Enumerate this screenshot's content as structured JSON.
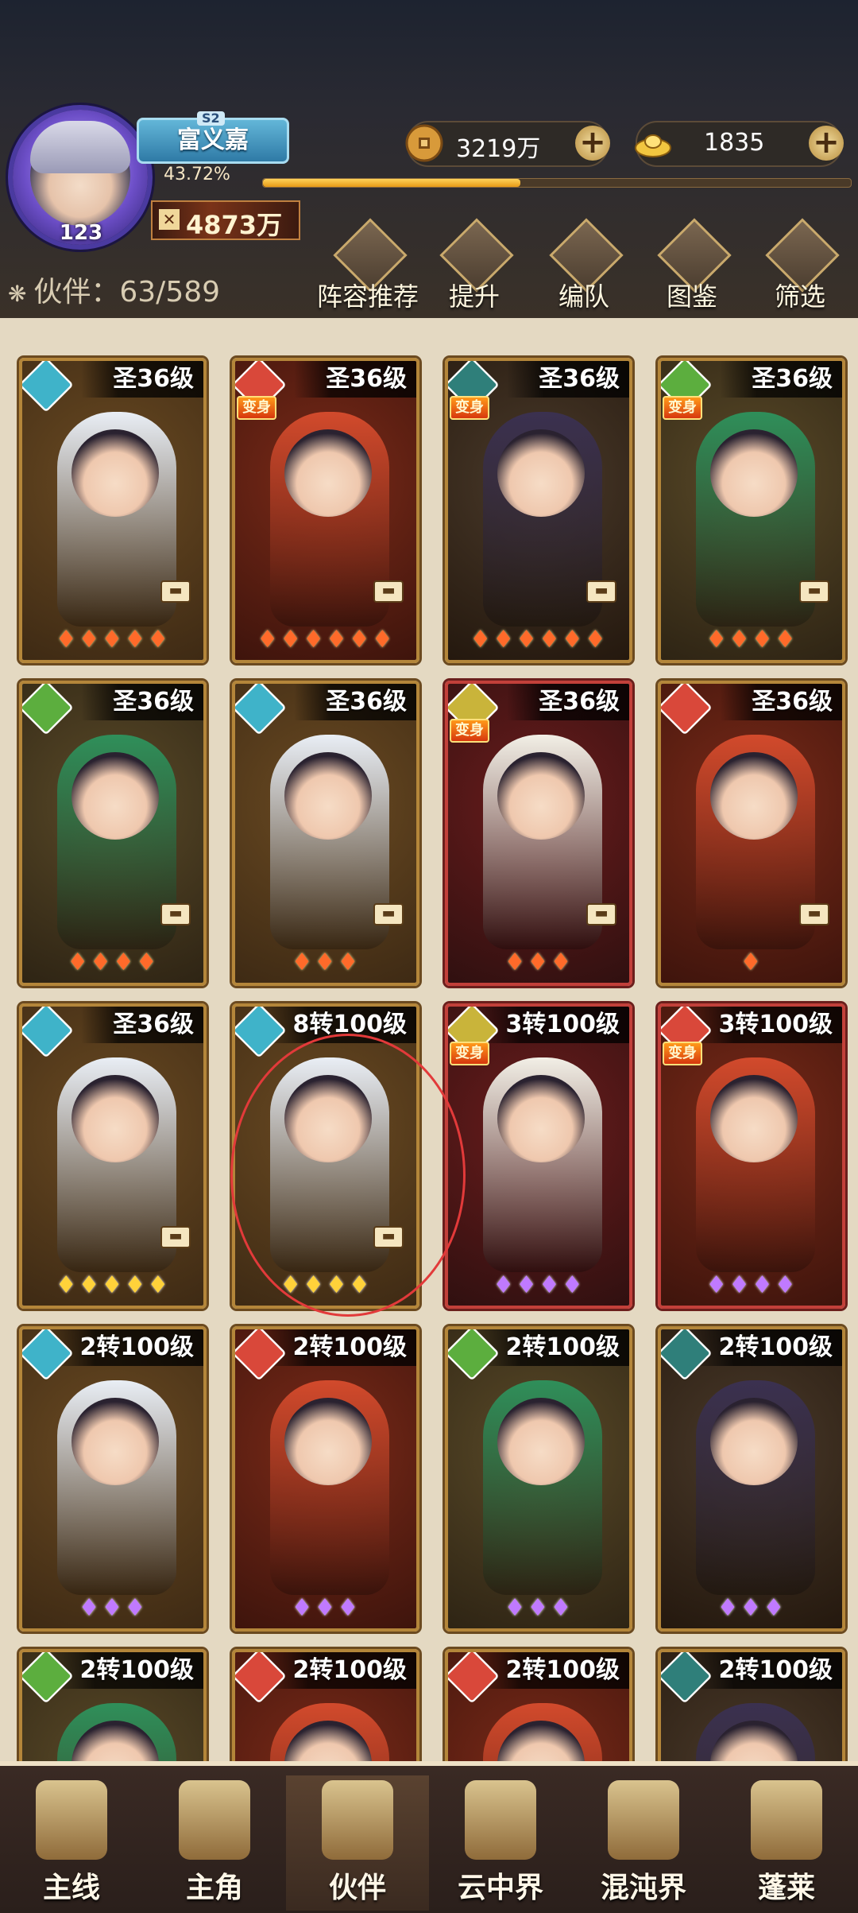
{
  "player": {
    "name": "富义嘉",
    "season": "S2",
    "level": "123",
    "exp_percent": "43.72%",
    "exp_fraction": 0.4372,
    "power": "4873万"
  },
  "resources": {
    "coins": "3219万",
    "ingots": "1835"
  },
  "partner_count": "伙伴：63/589",
  "features": [
    {
      "label": "阵容推荐",
      "icon": "lineup-recommend-icon"
    },
    {
      "label": "提升",
      "icon": "upgrade-icon"
    },
    {
      "label": "编队",
      "icon": "formation-icon"
    },
    {
      "label": "图鉴",
      "icon": "codex-icon"
    },
    {
      "label": "筛选",
      "icon": "filter-icon"
    }
  ],
  "transform_badge": "变身",
  "equip_mark": "▬",
  "cards": [
    {
      "level": "圣36级",
      "element": "water",
      "stars": 5,
      "star_color": "red",
      "transform": false,
      "frame": "gold"
    },
    {
      "level": "圣36级",
      "element": "fire",
      "stars": 6,
      "star_color": "red",
      "transform": true,
      "frame": "gold"
    },
    {
      "level": "圣36级",
      "element": "dark",
      "stars": 6,
      "star_color": "red",
      "transform": true,
      "frame": "gold"
    },
    {
      "level": "圣36级",
      "element": "wood",
      "stars": 4,
      "star_color": "red",
      "transform": true,
      "frame": "gold"
    },
    {
      "level": "圣36级",
      "element": "wood",
      "stars": 4,
      "star_color": "red",
      "transform": false,
      "frame": "gold"
    },
    {
      "level": "圣36级",
      "element": "water",
      "stars": 3,
      "star_color": "red",
      "transform": false,
      "frame": "gold"
    },
    {
      "level": "圣36级",
      "element": "light",
      "stars": 3,
      "star_color": "red",
      "transform": true,
      "frame": "red"
    },
    {
      "level": "圣36级",
      "element": "fire",
      "stars": 1,
      "star_color": "red",
      "transform": false,
      "frame": "gold"
    },
    {
      "level": "圣36级",
      "element": "water",
      "stars": 5,
      "star_color": "gold",
      "transform": false,
      "frame": "gold"
    },
    {
      "level": "8转100级",
      "element": "water",
      "stars": 4,
      "star_color": "gold",
      "transform": false,
      "frame": "gold"
    },
    {
      "level": "3转100级",
      "element": "light",
      "stars": 4,
      "star_color": "purple",
      "transform": true,
      "frame": "red"
    },
    {
      "level": "3转100级",
      "element": "fire",
      "stars": 4,
      "star_color": "purple",
      "transform": true,
      "frame": "red"
    },
    {
      "level": "2转100级",
      "element": "water",
      "stars": 3,
      "star_color": "purple",
      "transform": false,
      "frame": "gold"
    },
    {
      "level": "2转100级",
      "element": "fire",
      "stars": 3,
      "star_color": "purple",
      "transform": false,
      "frame": "gold"
    },
    {
      "level": "2转100级",
      "element": "wood",
      "stars": 3,
      "star_color": "purple",
      "transform": false,
      "frame": "gold"
    },
    {
      "level": "2转100级",
      "element": "dark",
      "stars": 3,
      "star_color": "purple",
      "transform": false,
      "frame": "gold"
    },
    {
      "level": "2转100级",
      "element": "wood",
      "stars": 0,
      "star_color": "purple",
      "transform": false,
      "frame": "gold"
    },
    {
      "level": "2转100级",
      "element": "fire",
      "stars": 0,
      "star_color": "purple",
      "transform": false,
      "frame": "gold"
    },
    {
      "level": "2转100级",
      "element": "fire",
      "stars": 0,
      "star_color": "purple",
      "transform": false,
      "frame": "gold"
    },
    {
      "level": "2转100级",
      "element": "dark",
      "stars": 0,
      "star_color": "purple",
      "transform": false,
      "frame": "gold"
    }
  ],
  "element_colors": {
    "water": "#3fb3c9",
    "fire": "#d9483a",
    "wood": "#5cae3e",
    "dark": "#2f7f7a",
    "light": "#c9b43a"
  },
  "nav": [
    {
      "label": "主线",
      "icon": "crossed-swords-icon",
      "active": false
    },
    {
      "label": "主角",
      "icon": "hero-portrait-icon",
      "active": false
    },
    {
      "label": "伙伴",
      "icon": "partner-crown-icon",
      "active": true
    },
    {
      "label": "云中界",
      "icon": "cloud-palace-icon",
      "active": false
    },
    {
      "label": "混沌界",
      "icon": "chaos-tower-icon",
      "active": false
    },
    {
      "label": "蓬莱",
      "icon": "penglai-sage-icon",
      "active": false
    }
  ]
}
